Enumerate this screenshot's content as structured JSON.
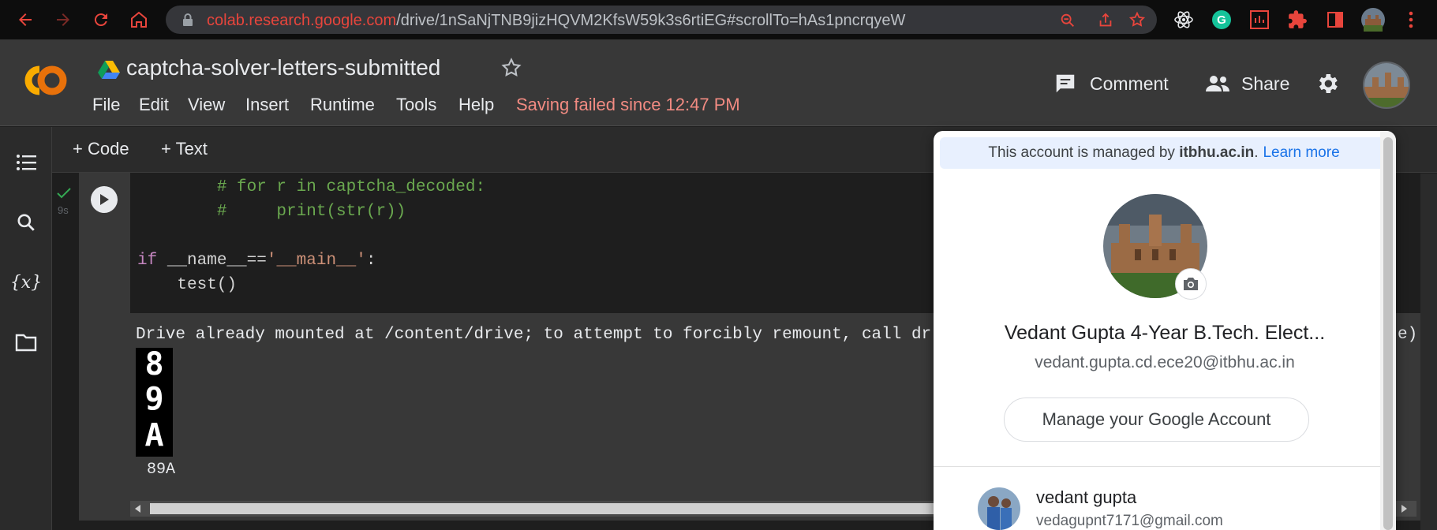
{
  "browser": {
    "url_domain": "colab.research.google.com",
    "url_path": "/drive/1nSaNjTNB9jizHQVM2KfsW59k3s6rtiEG#scrollTo=hAs1pncrqyeW"
  },
  "header": {
    "logo": "CO",
    "title": "captcha-solver-letters-submitted",
    "menu": [
      "File",
      "Edit",
      "View",
      "Insert",
      "Runtime",
      "Tools",
      "Help"
    ],
    "save_status": "Saving failed since 12:47 PM",
    "comment_label": "Comment",
    "share_label": "Share"
  },
  "toolbar": {
    "add_code": "+ Code",
    "add_text": "+ Text"
  },
  "rail": {
    "variables_label": "{x}"
  },
  "cell": {
    "exec_time": "9s",
    "code_lines": [
      "        # for r in captcha_decoded:",
      "        #     print(str(r))",
      "",
      "if __name__=='__main__':",
      "    test()"
    ],
    "output_text": "Drive already mounted at /content/drive; to attempt to forcibly remount, call dr",
    "output_text_tail": "e).",
    "captcha_chars": [
      "8",
      "9",
      "A"
    ],
    "prediction": "89A"
  },
  "account_popup": {
    "managed_prefix": "This account is managed by",
    "managed_domain": "itbhu.ac.in",
    "learn_more": "Learn more",
    "name": "Vedant Gupta 4-Year B.Tech. Elect...",
    "email": "vedant.gupta.cd.ece20@itbhu.ac.in",
    "manage_button": "Manage your Google Account",
    "other_account": {
      "name": "vedant gupta",
      "email": "vedagupnt7171@gmail.com"
    }
  },
  "colors": {
    "accent_orange": "#f9ab00",
    "error_red": "#f28b82",
    "link_blue": "#1a73e8"
  }
}
